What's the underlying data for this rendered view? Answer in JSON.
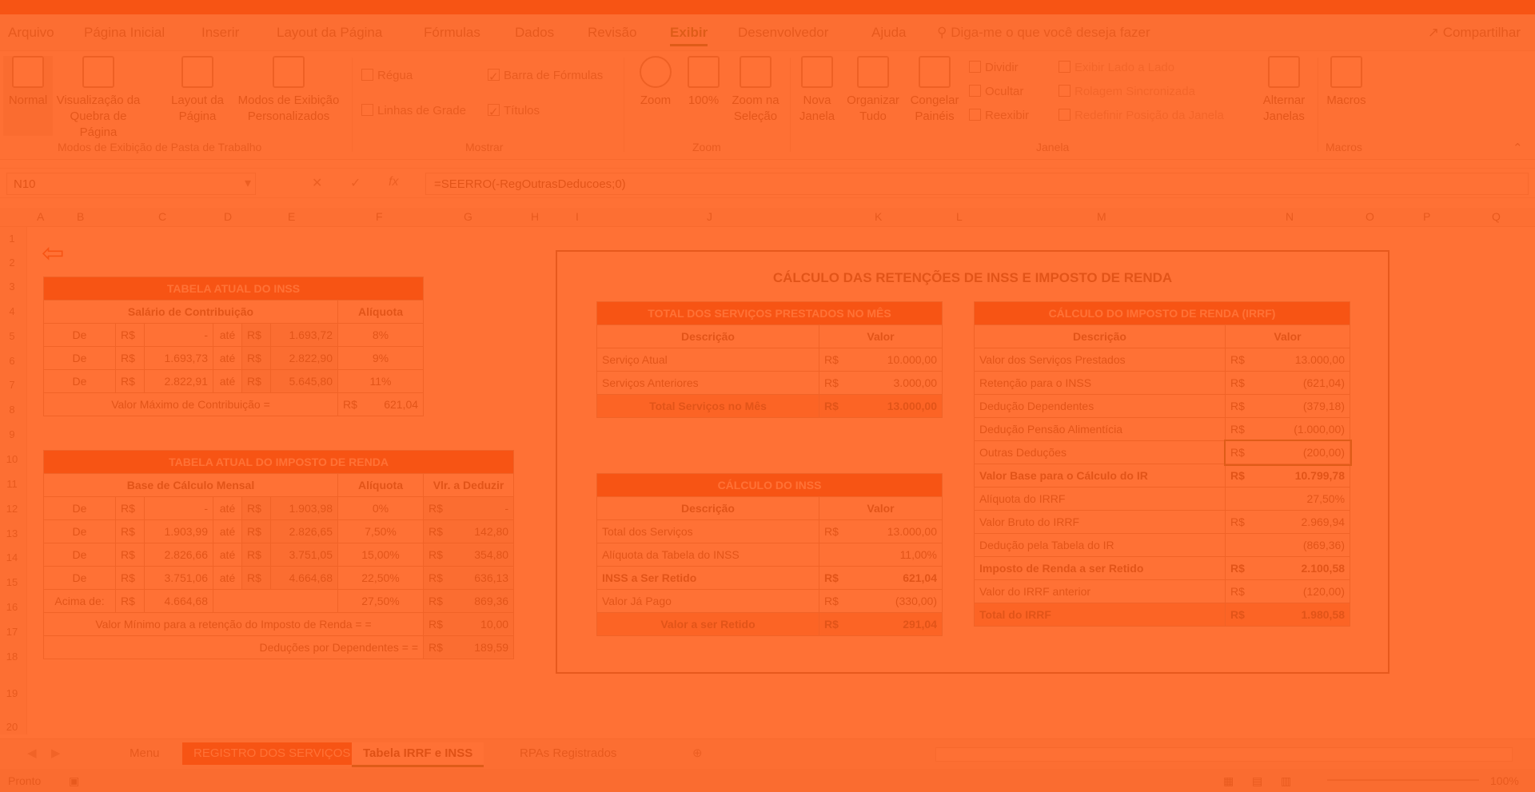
{
  "ribbon_tabs": [
    "Arquivo",
    "Página Inicial",
    "Inserir",
    "Layout da Página",
    "Fórmulas",
    "Dados",
    "Revisão",
    "Exibir",
    "Desenvolvedor",
    "Ajuda"
  ],
  "search_placeholder": "Diga-me o que você deseja fazer",
  "share_label": "Compartilhar",
  "ribbon": {
    "normal": "Normal",
    "page_break_preview": "Visualização da Quebra de Página",
    "page_layout": "Layout da Página",
    "custom_views": "Modos de Exibição Personalizados",
    "group_views": "Modos de Exibição de Pasta de Trabalho",
    "ruler": "Régua",
    "gridlines": "Linhas de Grade",
    "formula_bar": "Barra de Fórmulas",
    "headings": "Títulos",
    "group_show": "Mostrar",
    "zoom": "Zoom",
    "zoom100": "100%",
    "zoom_selection": "Zoom na Seleção",
    "group_zoom": "Zoom",
    "new_window": "Nova Janela",
    "arrange_all": "Organizar Tudo",
    "freeze_panes": "Congelar Painéis",
    "split": "Dividir",
    "hide": "Ocultar",
    "unhide": "Reexibir",
    "side_by_side": "Exibir Lado a Lado",
    "sync_scroll": "Rolagem Sincronizada",
    "reset_pos": "Redefinir Posição da Janela",
    "group_window": "Janela",
    "switch_windows": "Alternar Janelas",
    "macros": "Macros",
    "group_macros": "Macros"
  },
  "formula_bar": {
    "name_box": "N10",
    "formula": "=SEERRO(-RegOutrasDeducoes;0)"
  },
  "columns": [
    "A",
    "B",
    "C",
    "D",
    "E",
    "F",
    "G",
    "H",
    "I",
    "J",
    "K",
    "L",
    "M",
    "N",
    "O",
    "P",
    "Q"
  ],
  "rows": [
    "1",
    "2",
    "3",
    "4",
    "5",
    "6",
    "7",
    "8",
    "9",
    "10",
    "11",
    "12",
    "13",
    "14",
    "15",
    "16",
    "17",
    "18",
    "19",
    "20"
  ],
  "inss_table": {
    "title": "TABELA ATUAL DO INSS",
    "col1": "Salário de Contribuição",
    "col2": "Alíquota",
    "rows": [
      {
        "de": "De",
        "rs1": "R$",
        "v1": "-",
        "ate": "até",
        "rs2": "R$",
        "v2": "1.693,72",
        "aliq": "8%"
      },
      {
        "de": "De",
        "rs1": "R$",
        "v1": "1.693,73",
        "ate": "até",
        "rs2": "R$",
        "v2": "2.822,90",
        "aliq": "9%"
      },
      {
        "de": "De",
        "rs1": "R$",
        "v1": "2.822,91",
        "ate": "até",
        "rs2": "R$",
        "v2": "5.645,80",
        "aliq": "11%"
      }
    ],
    "max_label": "Valor Máximo de Contribuição =",
    "max_rs": "R$",
    "max_value": "621,04"
  },
  "ir_table": {
    "title": "TABELA ATUAL DO IMPOSTO DE RENDA",
    "col1": "Base de Cálculo Mensal",
    "col2": "Alíquota",
    "col3": "Vlr. a Deduzir",
    "rows": [
      {
        "de": "De",
        "rs1": "R$",
        "v1": "-",
        "ate": "até",
        "rs2": "R$",
        "v2": "1.903,98",
        "aliq": "0%",
        "rs3": "R$",
        "ded": "-"
      },
      {
        "de": "De",
        "rs1": "R$",
        "v1": "1.903,99",
        "ate": "até",
        "rs2": "R$",
        "v2": "2.826,65",
        "aliq": "7,50%",
        "rs3": "R$",
        "ded": "142,80"
      },
      {
        "de": "De",
        "rs1": "R$",
        "v1": "2.826,66",
        "ate": "até",
        "rs2": "R$",
        "v2": "3.751,05",
        "aliq": "15,00%",
        "rs3": "R$",
        "ded": "354,80"
      },
      {
        "de": "De",
        "rs1": "R$",
        "v1": "3.751,06",
        "ate": "até",
        "rs2": "R$",
        "v2": "4.664,68",
        "aliq": "22,50%",
        "rs3": "R$",
        "ded": "636,13"
      }
    ],
    "above": {
      "label": "Acima de:",
      "rs1": "R$",
      "v1": "4.664,68",
      "aliq": "27,50%",
      "rs3": "R$",
      "ded": "869,36"
    },
    "min_label": "Valor Mínimo para a retenção do Imposto de Renda = =",
    "min_rs": "R$",
    "min_value": "10,00",
    "dep_label": "Deduções por Dependentes = =",
    "dep_rs": "R$",
    "dep_value": "189,59"
  },
  "calc_title": "CÁLCULO DAS RETENÇÕES DE INSS E IMPOSTO DE RENDA",
  "services_table": {
    "title": "TOTAL DOS SERVIÇOS PRESTADOS NO MÊS",
    "col1": "Descrição",
    "col2": "Valor",
    "rows": [
      {
        "desc": "Serviço Atual",
        "rs": "R$",
        "val": "10.000,00"
      },
      {
        "desc": "Serviços Anteriores",
        "rs": "R$",
        "val": "3.000,00"
      }
    ],
    "total_label": "Total Serviços no Mês",
    "total_rs": "R$",
    "total_value": "13.000,00"
  },
  "inss_calc": {
    "title": "CÁLCULO DO INSS",
    "col1": "Descrição",
    "col2": "Valor",
    "rows": [
      {
        "desc": "Total dos Serviços",
        "rs": "R$",
        "val": "13.000,00",
        "bold": false
      },
      {
        "desc": "Alíquota da Tabela do INSS",
        "rs": "",
        "val": "11,00%",
        "bold": false
      },
      {
        "desc": "INSS a Ser Retido",
        "rs": "R$",
        "val": "621,04",
        "bold": true
      },
      {
        "desc": "Valor Já Pago",
        "rs": "R$",
        "val": "(330,00)",
        "bold": false
      }
    ],
    "total_label": "Valor a ser Retido",
    "total_rs": "R$",
    "total_value": "291,04"
  },
  "ir_calc": {
    "title": "CÁLCULO DO IMPOSTO DE RENDA (IRRF)",
    "col1": "Descrição",
    "col2": "Valor",
    "rows": [
      {
        "desc": "Valor dos Serviços Prestados",
        "rs": "R$",
        "val": "13.000,00",
        "bold": false
      },
      {
        "desc": "Retenção para o INSS",
        "rs": "R$",
        "val": "(621,04)",
        "bold": false
      },
      {
        "desc": "Dedução Dependentes",
        "rs": "R$",
        "val": "(379,18)",
        "bold": false
      },
      {
        "desc": "Dedução Pensão Alimentícia",
        "rs": "R$",
        "val": "(1.000,00)",
        "bold": false
      },
      {
        "desc": "Outras Deduções",
        "rs": "R$",
        "val": "(200,00)",
        "bold": false
      },
      {
        "desc": "Valor Base para o Cálculo do IR",
        "rs": "R$",
        "val": "10.799,78",
        "bold": true
      },
      {
        "desc": "Alíquota do IRRF",
        "rs": "",
        "val": "27,50%",
        "bold": false
      },
      {
        "desc": "Valor Bruto do IRRF",
        "rs": "R$",
        "val": "2.969,94",
        "bold": false
      },
      {
        "desc": "Dedução pela Tabela do IR",
        "rs": "",
        "val": "(869,36)",
        "bold": false
      },
      {
        "desc": "Imposto de Renda a ser Retido",
        "rs": "R$",
        "val": "2.100,58",
        "bold": true
      },
      {
        "desc": "Valor do IRRF anterior",
        "rs": "R$",
        "val": "(120,00)",
        "bold": false
      }
    ],
    "total_label": "Total do IRRF",
    "total_rs": "R$",
    "total_value": "1.980,58"
  },
  "sheet_tabs": [
    "Menu",
    "REGISTRO DOS SERVIÇOS",
    "Tabela IRRF e INSS",
    "RPAs Registrados"
  ],
  "status": {
    "mode": "Pronto",
    "zoom": "100%"
  },
  "colors": {
    "accent": "#c5371a",
    "overlay": "#ff5a14",
    "excel_green": "#1e6b35"
  }
}
